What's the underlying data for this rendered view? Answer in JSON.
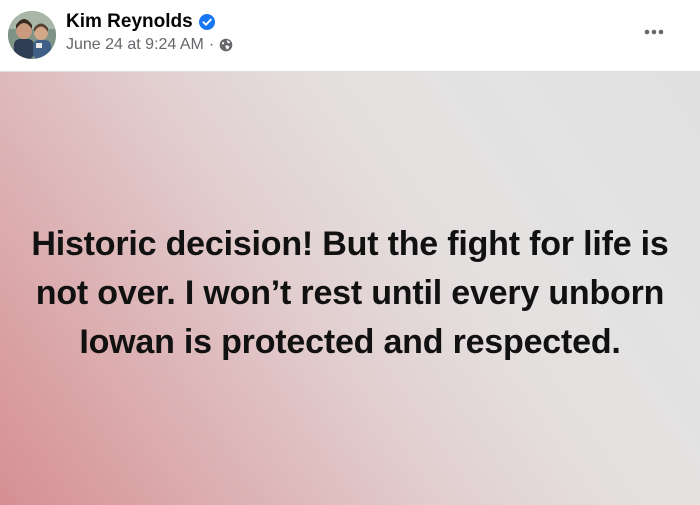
{
  "post": {
    "author": {
      "name": "Kim Reynolds",
      "verified": true,
      "verified_icon": "verified-badge-icon",
      "avatar_icon": "profile-photo"
    },
    "meta": {
      "timestamp": "June 24 at 9:24 AM",
      "separator": "·",
      "audience_icon": "globe-icon"
    },
    "menu_icon": "more-options-icon",
    "text": "Historic decision! But the fight for life is not over. I won’t rest until every unborn Iowan is protected and respected.",
    "background_gradient": [
      "#d68f93",
      "#e2cfd0",
      "#e0e0e0"
    ]
  },
  "colors": {
    "name": "#050505",
    "meta": "#65676b",
    "verified": "#1877f2",
    "body_text": "#111111"
  }
}
